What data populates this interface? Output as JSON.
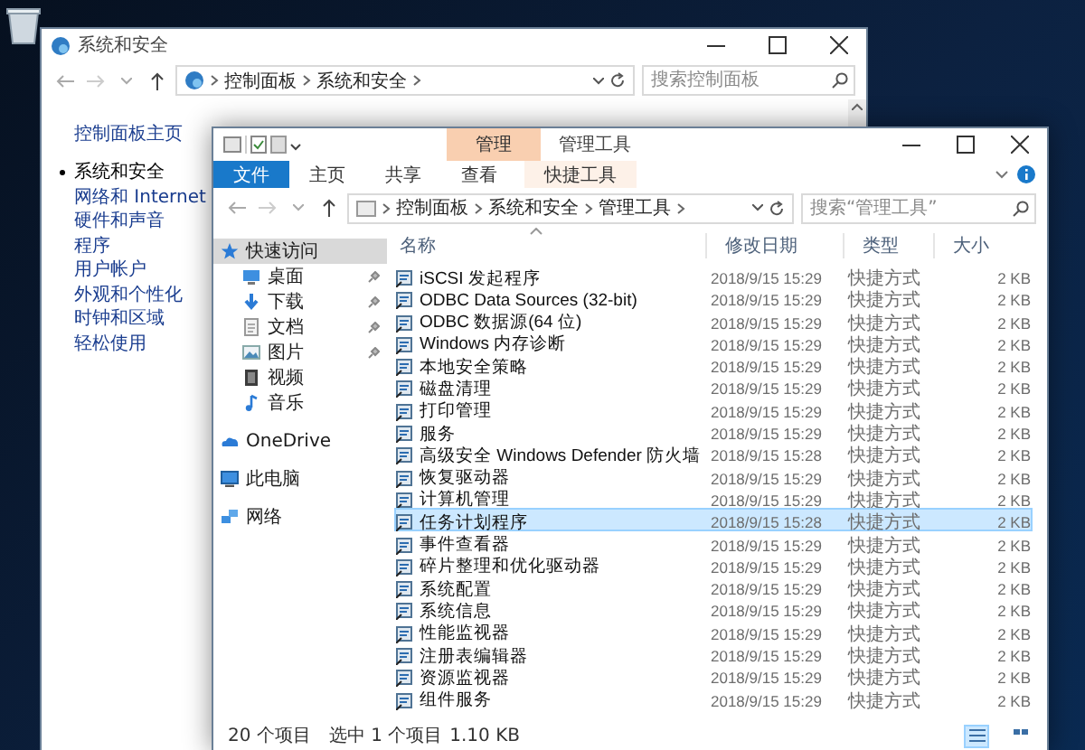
{
  "back_window": {
    "title": "系统和安全",
    "breadcrumb": [
      "控制面板",
      "系统和安全"
    ],
    "search": {
      "placeholder": "搜索控制面板"
    },
    "home_link": "控制面板主页",
    "categories": [
      {
        "label": "系统和安全",
        "selected": true
      },
      {
        "label": "网络和 Internet",
        "selected": false
      },
      {
        "label": "硬件和声音",
        "selected": false
      },
      {
        "label": "程序",
        "selected": false
      },
      {
        "label": "用户帐户",
        "selected": false
      },
      {
        "label": "外观和个性化",
        "selected": false
      },
      {
        "label": "时钟和区域",
        "selected": false
      },
      {
        "label": "轻松使用",
        "selected": false
      }
    ]
  },
  "front_window": {
    "title": "管理工具",
    "context_group": "管理",
    "ribbon_tabs": [
      {
        "label": "文件",
        "kind": "file"
      },
      {
        "label": "主页",
        "kind": "normal"
      },
      {
        "label": "共享",
        "kind": "normal"
      },
      {
        "label": "查看",
        "kind": "normal"
      },
      {
        "label": "快捷工具",
        "kind": "context"
      }
    ],
    "breadcrumb": [
      "控制面板",
      "系统和安全",
      "管理工具"
    ],
    "search": {
      "placeholder": "搜索“管理工具”"
    },
    "nav": [
      {
        "label": "快速访问",
        "kind": "star",
        "selected": true,
        "children": [
          {
            "label": "桌面",
            "kind": "desktop",
            "selected": false,
            "pinned": true
          },
          {
            "label": "下载",
            "kind": "download",
            "selected": false,
            "pinned": true
          },
          {
            "label": "文档",
            "kind": "document",
            "selected": false,
            "pinned": true
          },
          {
            "label": "图片",
            "kind": "picture",
            "selected": false,
            "pinned": true
          },
          {
            "label": "视频",
            "kind": "video",
            "selected": false,
            "pinned": false
          },
          {
            "label": "音乐",
            "kind": "music",
            "selected": false,
            "pinned": false
          }
        ]
      },
      {
        "label": "OneDrive",
        "kind": "cloud",
        "selected": false
      },
      {
        "label": "此电脑",
        "kind": "computer",
        "selected": false
      },
      {
        "label": "网络",
        "kind": "network",
        "selected": false
      }
    ],
    "columns": [
      "名称",
      "修改日期",
      "类型",
      "大小"
    ],
    "rows": [
      {
        "name": "iSCSI 发起程序",
        "date": "2018/9/15 15:29",
        "type": "快捷方式",
        "size": "2 KB",
        "selected": false
      },
      {
        "name": "ODBC Data Sources (32-bit)",
        "date": "2018/9/15 15:29",
        "type": "快捷方式",
        "size": "2 KB",
        "selected": false
      },
      {
        "name": "ODBC 数据源(64 位)",
        "date": "2018/9/15 15:29",
        "type": "快捷方式",
        "size": "2 KB",
        "selected": false
      },
      {
        "name": "Windows 内存诊断",
        "date": "2018/9/15 15:29",
        "type": "快捷方式",
        "size": "2 KB",
        "selected": false
      },
      {
        "name": "本地安全策略",
        "date": "2018/9/15 15:29",
        "type": "快捷方式",
        "size": "2 KB",
        "selected": false
      },
      {
        "name": "磁盘清理",
        "date": "2018/9/15 15:29",
        "type": "快捷方式",
        "size": "2 KB",
        "selected": false
      },
      {
        "name": "打印管理",
        "date": "2018/9/15 15:29",
        "type": "快捷方式",
        "size": "2 KB",
        "selected": false
      },
      {
        "name": "服务",
        "date": "2018/9/15 15:29",
        "type": "快捷方式",
        "size": "2 KB",
        "selected": false
      },
      {
        "name": "高级安全 Windows Defender 防火墙",
        "date": "2018/9/15 15:28",
        "type": "快捷方式",
        "size": "2 KB",
        "selected": false
      },
      {
        "name": "恢复驱动器",
        "date": "2018/9/15 15:29",
        "type": "快捷方式",
        "size": "2 KB",
        "selected": false
      },
      {
        "name": "计算机管理",
        "date": "2018/9/15 15:29",
        "type": "快捷方式",
        "size": "2 KB",
        "selected": false
      },
      {
        "name": "任务计划程序",
        "date": "2018/9/15 15:28",
        "type": "快捷方式",
        "size": "2 KB",
        "selected": true
      },
      {
        "name": "事件查看器",
        "date": "2018/9/15 15:29",
        "type": "快捷方式",
        "size": "2 KB",
        "selected": false
      },
      {
        "name": "碎片整理和优化驱动器",
        "date": "2018/9/15 15:29",
        "type": "快捷方式",
        "size": "2 KB",
        "selected": false
      },
      {
        "name": "系统配置",
        "date": "2018/9/15 15:29",
        "type": "快捷方式",
        "size": "2 KB",
        "selected": false
      },
      {
        "name": "系统信息",
        "date": "2018/9/15 15:29",
        "type": "快捷方式",
        "size": "2 KB",
        "selected": false
      },
      {
        "name": "性能监视器",
        "date": "2018/9/15 15:29",
        "type": "快捷方式",
        "size": "2 KB",
        "selected": false
      },
      {
        "name": "注册表编辑器",
        "date": "2018/9/15 15:29",
        "type": "快捷方式",
        "size": "2 KB",
        "selected": false
      },
      {
        "name": "资源监视器",
        "date": "2018/9/15 15:29",
        "type": "快捷方式",
        "size": "2 KB",
        "selected": false
      },
      {
        "name": "组件服务",
        "date": "2018/9/15 15:29",
        "type": "快捷方式",
        "size": "2 KB",
        "selected": false
      }
    ],
    "status_bar": {
      "count": "20 个项目",
      "selection": "选中 1 个项目",
      "size": "1.10 KB"
    }
  }
}
